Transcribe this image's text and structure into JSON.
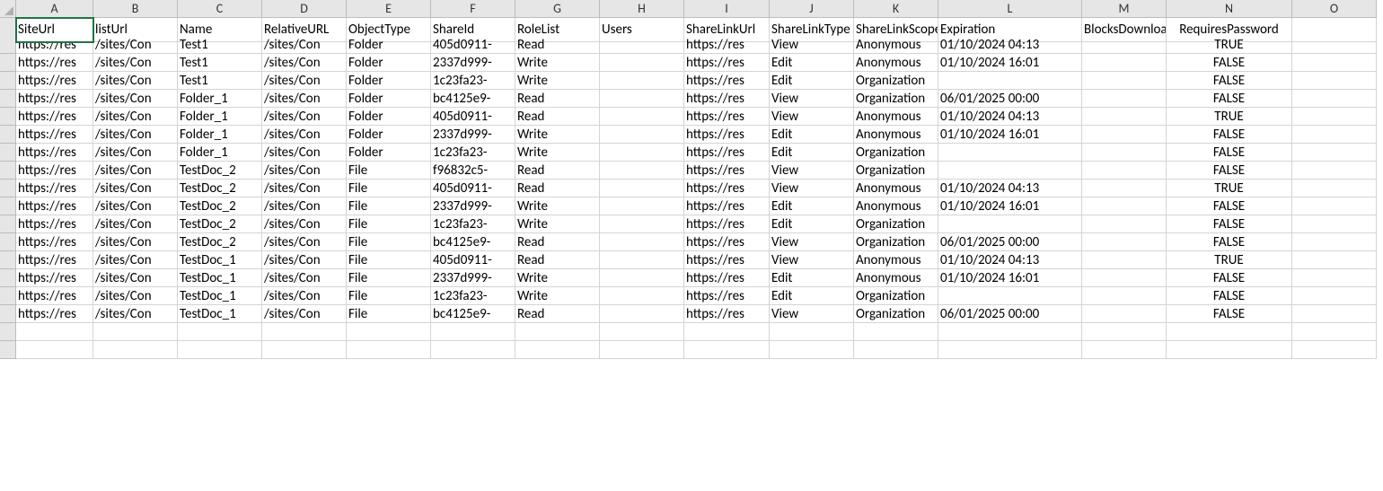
{
  "columns": [
    "A",
    "B",
    "C",
    "D",
    "E",
    "F",
    "G",
    "H",
    "I",
    "J",
    "K",
    "L",
    "M",
    "N",
    "O"
  ],
  "headers": {
    "A": "SiteUrl",
    "B": "listUrl",
    "C": "Name",
    "D": "RelativeURL",
    "E": "ObjectType",
    "F": "ShareId",
    "G": "RoleList",
    "H": "Users",
    "I": "ShareLinkUrl",
    "J": "ShareLinkType",
    "K": "ShareLinkScope",
    "L": "Expiration",
    "M": "BlocksDownload",
    "N": "RequiresPassword",
    "O": ""
  },
  "rows": [
    {
      "A": "https://res",
      "B": "/sites/Con",
      "C": "Test1",
      "D": "/sites/Con",
      "E": "Folder",
      "F": "405d0911-",
      "G": "Read",
      "H": "",
      "I": "https://res",
      "J": "View",
      "K": "Anonymous",
      "L": "01/10/2024 04:13",
      "M": "",
      "N": "TRUE",
      "O": ""
    },
    {
      "A": "https://res",
      "B": "/sites/Con",
      "C": "Test1",
      "D": "/sites/Con",
      "E": "Folder",
      "F": "2337d999-",
      "G": "Write",
      "H": "",
      "I": "https://res",
      "J": "Edit",
      "K": "Anonymous",
      "L": "01/10/2024 16:01",
      "M": "",
      "N": "FALSE",
      "O": ""
    },
    {
      "A": "https://res",
      "B": "/sites/Con",
      "C": "Test1",
      "D": "/sites/Con",
      "E": "Folder",
      "F": "1c23fa23-",
      "G": "Write",
      "H": "",
      "I": "https://res",
      "J": "Edit",
      "K": "Organization",
      "L": "",
      "M": "",
      "N": "FALSE",
      "O": ""
    },
    {
      "A": "https://res",
      "B": "/sites/Con",
      "C": "Folder_1",
      "D": "/sites/Con",
      "E": "Folder",
      "F": "bc4125e9-",
      "G": "Read",
      "H": "",
      "I": "https://res",
      "J": "View",
      "K": "Organization",
      "L": "06/01/2025 00:00",
      "M": "",
      "N": "FALSE",
      "O": ""
    },
    {
      "A": "https://res",
      "B": "/sites/Con",
      "C": "Folder_1",
      "D": "/sites/Con",
      "E": "Folder",
      "F": "405d0911-",
      "G": "Read",
      "H": "",
      "I": "https://res",
      "J": "View",
      "K": "Anonymous",
      "L": "01/10/2024 04:13",
      "M": "",
      "N": "TRUE",
      "O": ""
    },
    {
      "A": "https://res",
      "B": "/sites/Con",
      "C": "Folder_1",
      "D": "/sites/Con",
      "E": "Folder",
      "F": "2337d999-",
      "G": "Write",
      "H": "",
      "I": "https://res",
      "J": "Edit",
      "K": "Anonymous",
      "L": "01/10/2024 16:01",
      "M": "",
      "N": "FALSE",
      "O": ""
    },
    {
      "A": "https://res",
      "B": "/sites/Con",
      "C": "Folder_1",
      "D": "/sites/Con",
      "E": "Folder",
      "F": "1c23fa23-",
      "G": "Write",
      "H": "",
      "I": "https://res",
      "J": "Edit",
      "K": "Organization",
      "L": "",
      "M": "",
      "N": "FALSE",
      "O": ""
    },
    {
      "A": "https://res",
      "B": "/sites/Con",
      "C": "TestDoc_2",
      "D": "/sites/Con",
      "E": "File",
      "F": "f96832c5-",
      "G": "Read",
      "H": "",
      "I": "https://res",
      "J": "View",
      "K": "Organization",
      "L": "",
      "M": "",
      "N": "FALSE",
      "O": ""
    },
    {
      "A": "https://res",
      "B": "/sites/Con",
      "C": "TestDoc_2",
      "D": "/sites/Con",
      "E": "File",
      "F": "405d0911-",
      "G": "Read",
      "H": "",
      "I": "https://res",
      "J": "View",
      "K": "Anonymous",
      "L": "01/10/2024 04:13",
      "M": "",
      "N": "TRUE",
      "O": ""
    },
    {
      "A": "https://res",
      "B": "/sites/Con",
      "C": "TestDoc_2",
      "D": "/sites/Con",
      "E": "File",
      "F": "2337d999-",
      "G": "Write",
      "H": "",
      "I": "https://res",
      "J": "Edit",
      "K": "Anonymous",
      "L": "01/10/2024 16:01",
      "M": "",
      "N": "FALSE",
      "O": ""
    },
    {
      "A": "https://res",
      "B": "/sites/Con",
      "C": "TestDoc_2",
      "D": "/sites/Con",
      "E": "File",
      "F": "1c23fa23-",
      "G": "Write",
      "H": "",
      "I": "https://res",
      "J": "Edit",
      "K": "Organization",
      "L": "",
      "M": "",
      "N": "FALSE",
      "O": ""
    },
    {
      "A": "https://res",
      "B": "/sites/Con",
      "C": "TestDoc_2",
      "D": "/sites/Con",
      "E": "File",
      "F": "bc4125e9-",
      "G": "Read",
      "H": "",
      "I": "https://res",
      "J": "View",
      "K": "Organization",
      "L": "06/01/2025 00:00",
      "M": "",
      "N": "FALSE",
      "O": ""
    },
    {
      "A": "https://res",
      "B": "/sites/Con",
      "C": "TestDoc_1",
      "D": "/sites/Con",
      "E": "File",
      "F": "405d0911-",
      "G": "Read",
      "H": "",
      "I": "https://res",
      "J": "View",
      "K": "Anonymous",
      "L": "01/10/2024 04:13",
      "M": "",
      "N": "TRUE",
      "O": ""
    },
    {
      "A": "https://res",
      "B": "/sites/Con",
      "C": "TestDoc_1",
      "D": "/sites/Con",
      "E": "File",
      "F": "2337d999-",
      "G": "Write",
      "H": "",
      "I": "https://res",
      "J": "Edit",
      "K": "Anonymous",
      "L": "01/10/2024 16:01",
      "M": "",
      "N": "FALSE",
      "O": ""
    },
    {
      "A": "https://res",
      "B": "/sites/Con",
      "C": "TestDoc_1",
      "D": "/sites/Con",
      "E": "File",
      "F": "1c23fa23-",
      "G": "Write",
      "H": "",
      "I": "https://res",
      "J": "Edit",
      "K": "Organization",
      "L": "",
      "M": "",
      "N": "FALSE",
      "O": ""
    },
    {
      "A": "https://res",
      "B": "/sites/Con",
      "C": "TestDoc_1",
      "D": "/sites/Con",
      "E": "File",
      "F": "bc4125e9-",
      "G": "Read",
      "H": "",
      "I": "https://res",
      "J": "View",
      "K": "Organization",
      "L": "06/01/2025 00:00",
      "M": "",
      "N": "FALSE",
      "O": ""
    }
  ],
  "blankRows": 2,
  "centerCols": [
    "N"
  ]
}
